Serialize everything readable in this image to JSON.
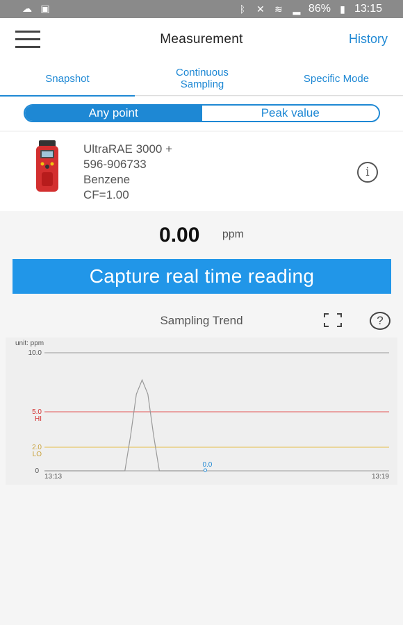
{
  "statusbar": {
    "battery": "86%",
    "time": "13:15",
    "left_icons": [
      "cloud-icon",
      "gallery-icon"
    ],
    "right_icons": [
      "bluetooth-icon",
      "mute-icon",
      "wifi-icon",
      "signal-icon",
      "battery-icon"
    ]
  },
  "appbar": {
    "title": "Measurement",
    "history_label": "History"
  },
  "tabs": [
    {
      "label": "Snapshot",
      "active": true
    },
    {
      "label": "Continuous Sampling",
      "active": false
    },
    {
      "label": "Specific Mode",
      "active": false
    }
  ],
  "segment": {
    "options": [
      "Any point",
      "Peak value"
    ],
    "selected": "Any point"
  },
  "device": {
    "model": "UltraRAE 3000 +",
    "serial": "596-906733",
    "gas": "Benzene",
    "cf": "CF=1.00"
  },
  "reading": {
    "value": "0.00",
    "unit": "ppm"
  },
  "capture_label": "Capture real time reading",
  "trend": {
    "title": "Sampling Trend"
  },
  "colors": {
    "accent": "#1e88d4",
    "button": "#2196e8",
    "hi_line": "#e57373",
    "lo_line": "#e8c66a",
    "trend_line": "#999999",
    "point_label": "#1e88d4"
  },
  "chart_data": {
    "type": "line",
    "unit_label": "unit: ppm",
    "ylim": [
      0,
      10
    ],
    "y_ticks": [
      "10.0",
      "5.0",
      "2.0",
      "0"
    ],
    "thresholds": [
      {
        "label": "HI",
        "value": 5.0,
        "tick": "5.0"
      },
      {
        "label": "LO",
        "value": 2.0,
        "tick": "2.0"
      }
    ],
    "x_ticks": [
      "13:13",
      "13:19"
    ],
    "x_range_minutes": [
      0,
      6
    ],
    "series": [
      {
        "x": [
          0,
          1.4,
          1.5,
          1.6,
          1.7,
          1.8,
          1.9,
          2.0,
          2.8
        ],
        "y": [
          0,
          0,
          3.0,
          6.5,
          7.7,
          6.5,
          3.0,
          0,
          0
        ]
      }
    ],
    "point_annotation": {
      "x": 2.8,
      "y": 0,
      "label": "0.0"
    },
    "grid": false
  }
}
